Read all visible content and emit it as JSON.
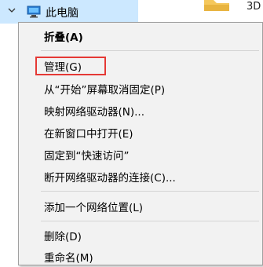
{
  "tree": {
    "label": "此电脑"
  },
  "corner_text": "3D",
  "menu": {
    "collapse": "折叠(A)",
    "manage": "管理(G)",
    "unpin_start": "从“开始”屏幕取消固定(P)",
    "map_drive": "映射网络驱动器(N)...",
    "open_new_window": "在新窗口中打开(E)",
    "pin_quick_access": "固定到“快速访问”",
    "disconnect_drive": "断开网络驱动器的连接(C)...",
    "add_network_location": "添加一个网络位置(L)",
    "delete": "删除(D)",
    "rename": "重命名(M)"
  },
  "colors": {
    "selection": "#cce8ff",
    "menu_bg": "#f2f2f2",
    "highlight": "#e53935"
  }
}
